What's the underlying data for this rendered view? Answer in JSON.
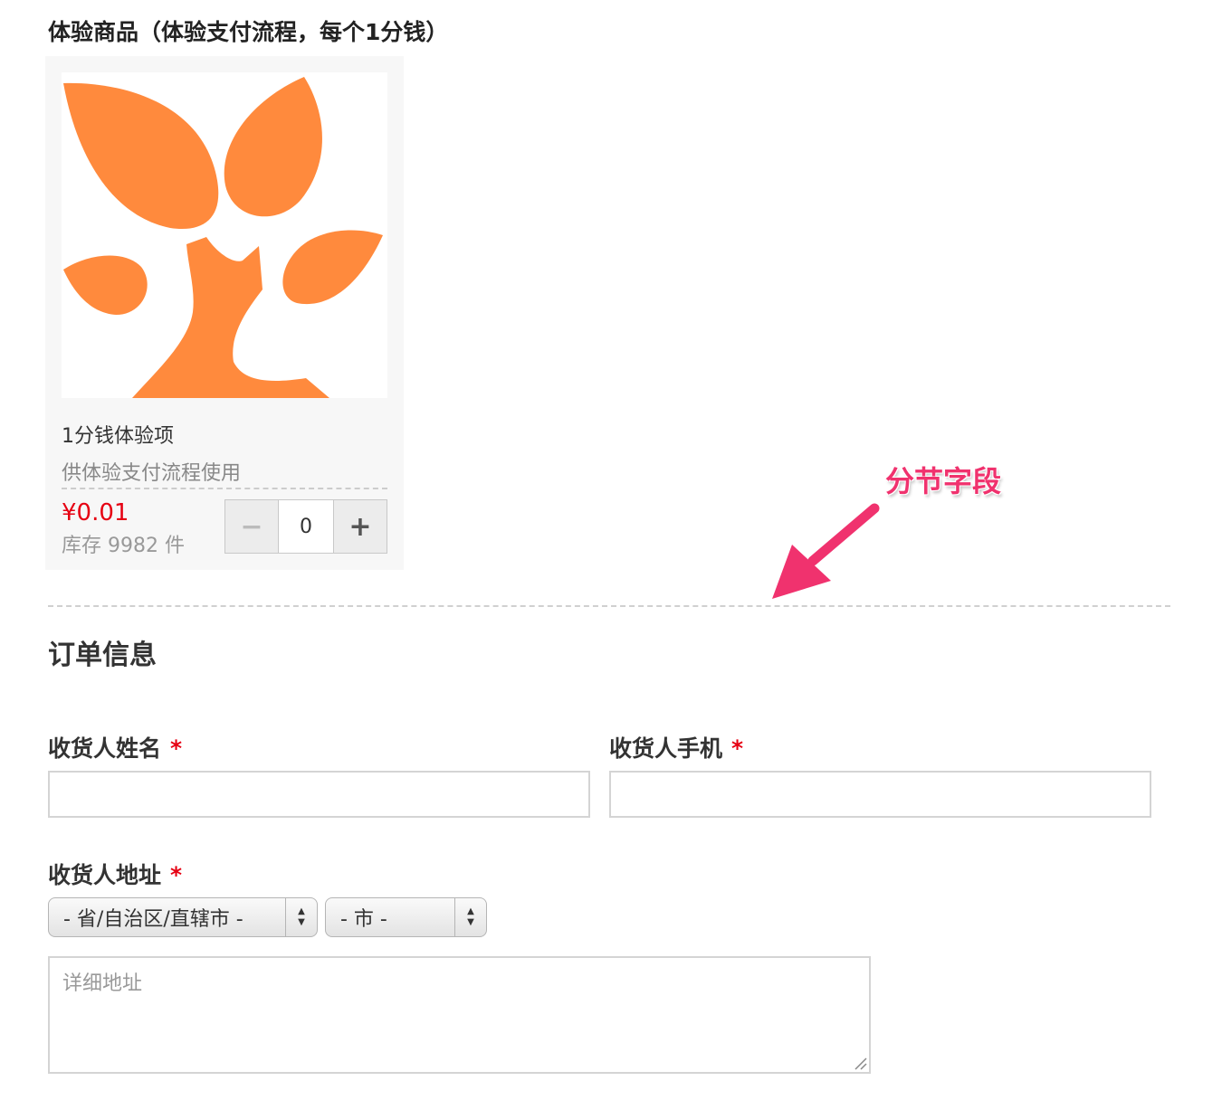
{
  "product_section": {
    "title": "体验商品（体验支付流程，每个1分钱）"
  },
  "product": {
    "name": "1分钱体验项",
    "description": "供体验支付流程使用",
    "price": "¥0.01",
    "stock": "库存 9982 件",
    "quantity": "0",
    "minus_label": "−",
    "plus_label": "+",
    "image_icon": "orange-tree-logo"
  },
  "annotation": {
    "text": "分节字段",
    "color": "#f0326e"
  },
  "order_section": {
    "title": "订单信息"
  },
  "fields": {
    "required_mark": "*",
    "name_label": "收货人姓名",
    "name_value": "",
    "phone_label": "收货人手机",
    "phone_value": "",
    "address_label": "收货人地址",
    "province_select": "- 省/自治区/直辖市 -",
    "city_select": "- 市 -",
    "address_placeholder": "详细地址"
  },
  "colors": {
    "accent_orange": "#ff8a3d",
    "price_red": "#e60012",
    "annotation_pink": "#f0326e"
  }
}
